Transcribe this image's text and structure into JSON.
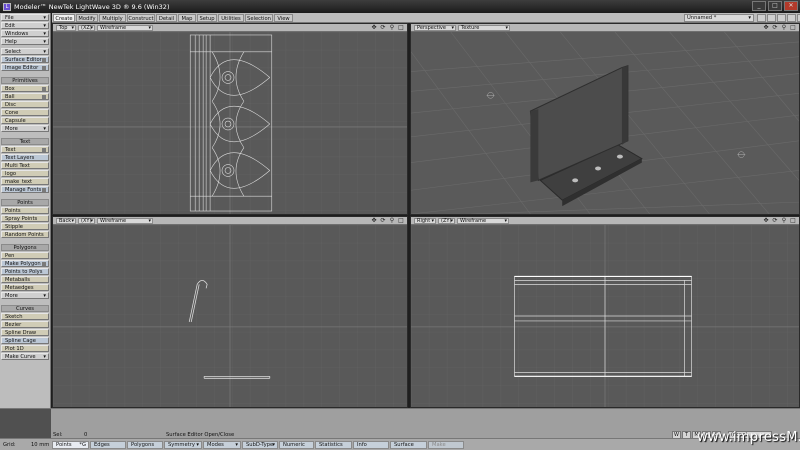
{
  "window": {
    "title": "Modeler™ NewTek LightWave 3D ® 9.6  (Win32)",
    "buttons": [
      "_",
      "□",
      "✕"
    ]
  },
  "tabs": [
    "Create",
    "Modify",
    "Multiply",
    "Construct",
    "Detail",
    "Map",
    "Setup",
    "Utilities",
    "Selection",
    "View"
  ],
  "active_tab": "Create",
  "object_selector": "Unnamed *",
  "left_menu": {
    "file": "File",
    "edit": "Edit",
    "windows": "Windows",
    "help": "Help",
    "select": "Select",
    "surface_editor": "Surface Editor",
    "image_editor": "Image Editor",
    "primitives_header": "Primitives",
    "box": "Box",
    "ball": "Ball",
    "disc": "Disc",
    "cone": "Cone",
    "capsule": "Capsule",
    "more1": "More",
    "text_header": "Text",
    "text": "Text",
    "text_layers": "Text Layers",
    "multi_text": "Multi Text",
    "logo": "logo",
    "make_text": "make_text",
    "manage_fonts": "Manage Fonts",
    "points_header": "Points",
    "points": "Points",
    "spray_points": "Spray Points",
    "stipple": "Stipple",
    "random_points": "Random Points",
    "polygons_header": "Polygons",
    "pen": "Pen",
    "make_polygon": "Make Polygon",
    "points_to_polys": "Points to Polys",
    "metaballs": "Metaballs",
    "metaedges": "Metaedges",
    "more2": "More",
    "curves_header": "Curves",
    "sketch": "Sketch",
    "bezier": "Bezier",
    "spline_draw": "Spline Draw",
    "spline_cage": "Spline Cage",
    "plot_1d": "Plot 1D",
    "make_curve": "Make Curve"
  },
  "viewports": {
    "top": {
      "view": "Top",
      "axis": "(XZ)",
      "mode": "Wireframe"
    },
    "perspective": {
      "view": "Perspective",
      "mode": "Texture"
    },
    "back": {
      "view": "Back",
      "axis": "(XY)",
      "mode": "Wireframe"
    },
    "right": {
      "view": "Right",
      "axis": "(ZY)",
      "mode": "Wireframe"
    }
  },
  "status": {
    "sel_label": "Sel:",
    "sel_value": "0",
    "message": "Surface Editor Open/Close",
    "grid_label": "Grid:",
    "grid_value": "10 mm"
  },
  "modebar": {
    "points": "Points",
    "points_key": "*G",
    "edges": "Edges",
    "polygons": "Polygons",
    "symmetry": "Symmetry",
    "modes": "Modes",
    "subd": "SubD-Type",
    "numeric": "Numeric",
    "statistics": "Statistics",
    "info": "Info",
    "surface": "Surface",
    "make": "Make"
  },
  "layer_buttons": [
    "W",
    "T",
    "M",
    "C",
    "S"
  ],
  "layer_selector": "(none)",
  "watermark": "www.impressM.com",
  "colors": {
    "viewport_bg": "#595959",
    "grid_line": "#666666",
    "wire": "#dcdcdc",
    "object_grey": "#4e4e4e"
  }
}
